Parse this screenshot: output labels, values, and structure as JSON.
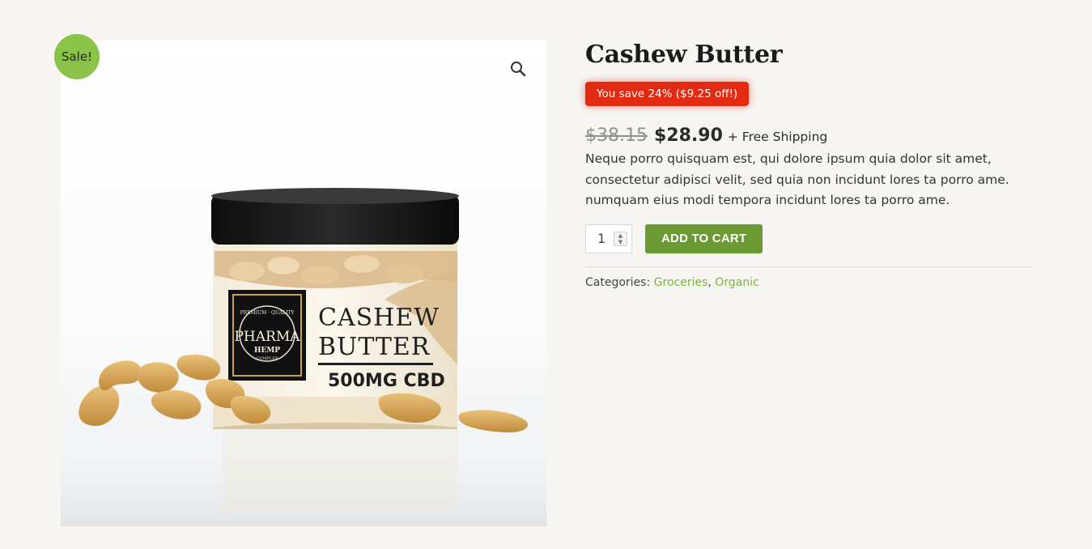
{
  "product": {
    "title": "Cashew Butter",
    "sale_badge": "Sale!",
    "save_badge": "You save 24% ($9.25 off!)",
    "price_old": "$38.15",
    "price_new": "$28.90",
    "shipping": "+ Free Shipping",
    "description": "Neque porro quisquam est, qui dolore ipsum quia dolor sit amet, consectetur adipisci velit, sed quia non incidunt lores ta porro ame. numquam eius modi tempora incidunt lores ta porro ame.",
    "quantity": "1",
    "add_to_cart": "ADD TO CART",
    "categories_label": "Categories:",
    "categories": [
      "Groceries",
      "Organic"
    ],
    "separator": ","
  },
  "image": {
    "label_brand": "PHARMA",
    "label_brand_sub": "HEMP",
    "label_ring_top": "PREMIUM · QUALITY",
    "label_ring_bottom": "COMPLEX",
    "label_line1": "CASHEW",
    "label_line2": "BUTTER",
    "label_line3": "500MG CBD"
  },
  "colors": {
    "sale_green": "#8bc34a",
    "button_green": "#6b9a35",
    "save_red": "#e32b14",
    "link_green": "#7cb342"
  },
  "icons": {
    "zoom": "magnifier-icon",
    "stepper_up": "chevron-up-icon",
    "stepper_down": "chevron-down-icon"
  }
}
